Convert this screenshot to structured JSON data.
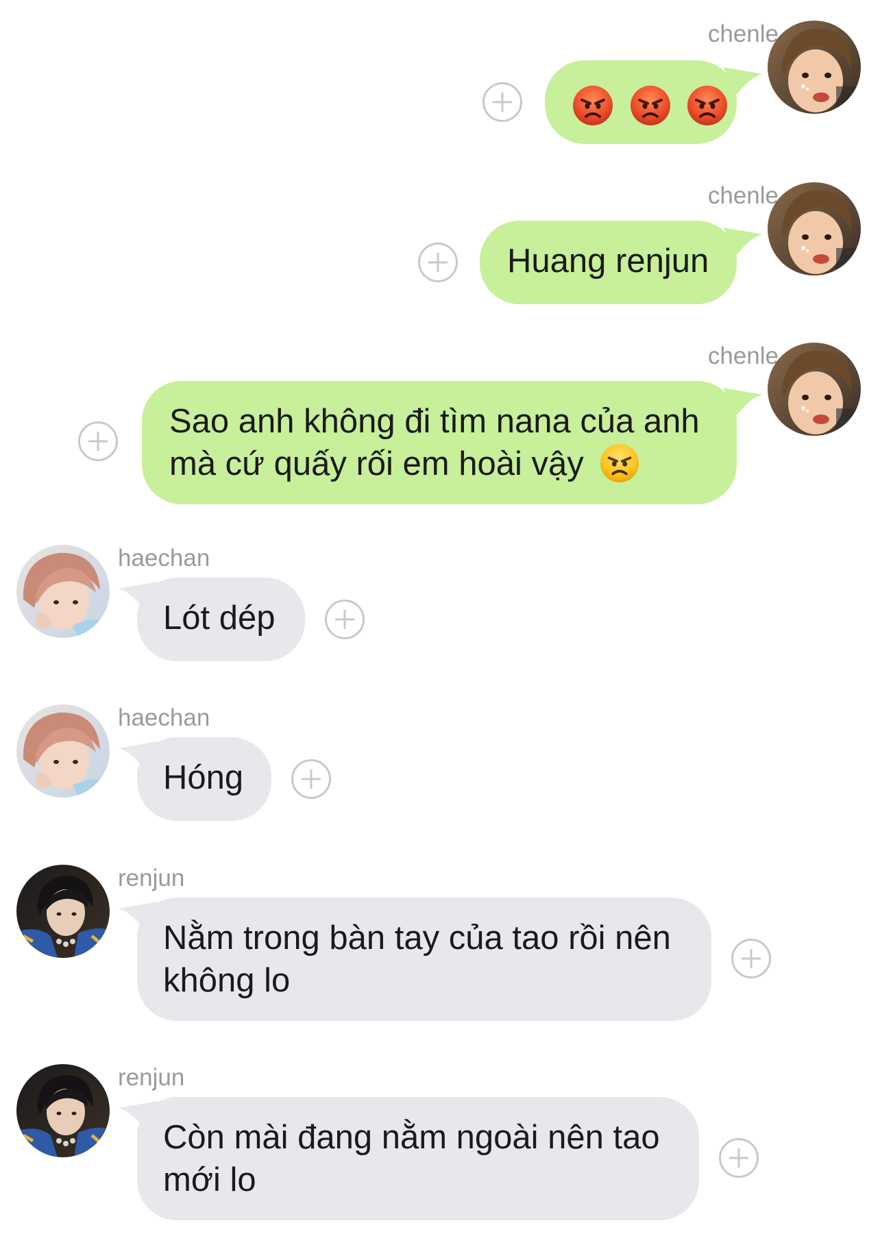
{
  "messages": [
    {
      "sender": "chenle",
      "direction": "sent",
      "text": "",
      "emoji": [
        "angry-face-red",
        "angry-face-red",
        "angry-face-red"
      ]
    },
    {
      "sender": "chenle",
      "direction": "sent",
      "text": "Huang renjun"
    },
    {
      "sender": "chenle",
      "direction": "sent",
      "line1": "Sao anh không đi tìm nana của anh",
      "line2": "mà cứ quấy rối em hoài vậy",
      "trailing_emoji": "angry-face-yellow"
    },
    {
      "sender": "haechan",
      "direction": "received",
      "text": "Lót dép"
    },
    {
      "sender": "haechan",
      "direction": "received",
      "text": "Hóng"
    },
    {
      "sender": "renjun",
      "direction": "received",
      "line1": "Nằm trong bàn tay của tao rồi nên",
      "line2": "không lo"
    },
    {
      "sender": "renjun",
      "direction": "received",
      "line1": "Còn mài đang nằm ngoài nên tao",
      "line2": "mới lo"
    }
  ],
  "icons": {
    "add_reaction": "plus-circle-icon",
    "avatar_chenle": "avatar-chenle",
    "avatar_haechan": "avatar-haechan",
    "avatar_renjun": "avatar-renjun"
  },
  "colors": {
    "sent_bubble": "#c8ef9a",
    "received_bubble": "#e6e8ec",
    "sender_name": "#9a9a9a",
    "plus_icon": "#c9c9c9",
    "background": "#ffffff"
  }
}
